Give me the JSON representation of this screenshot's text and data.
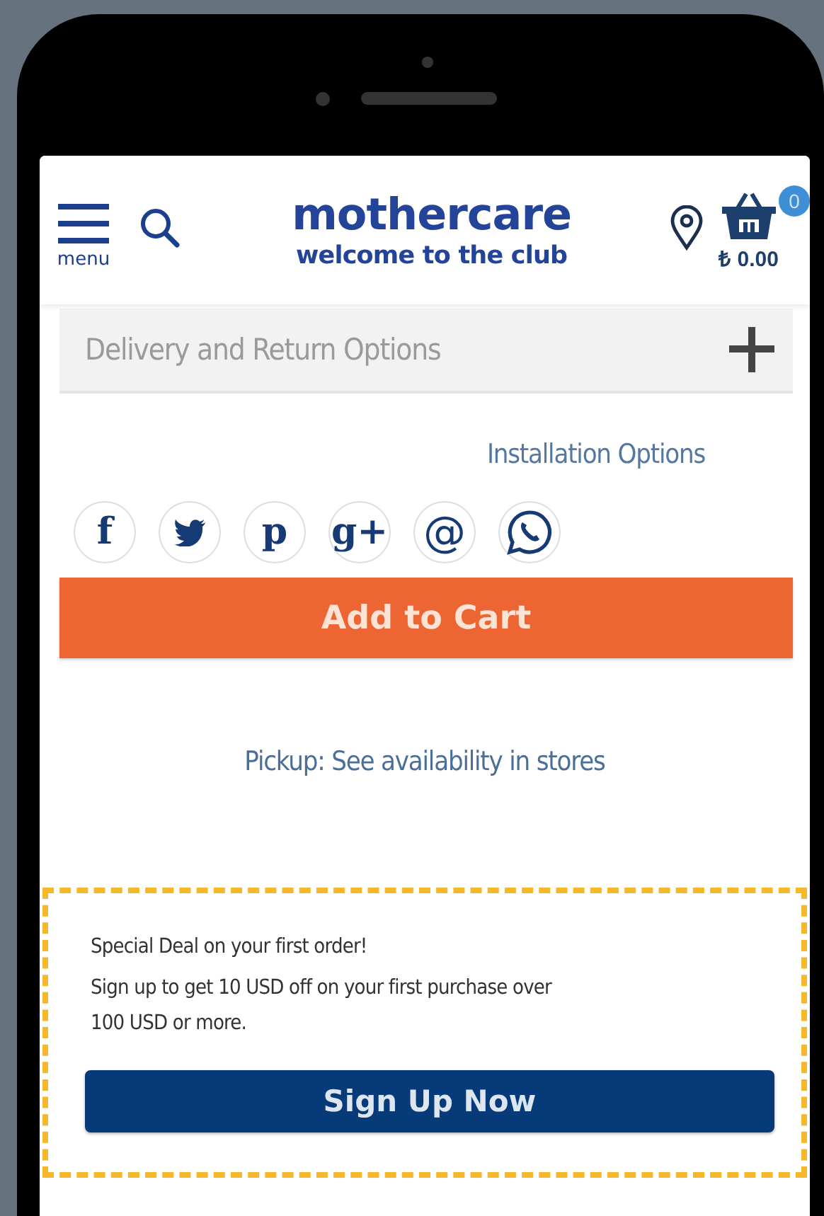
{
  "header": {
    "menu_label": "menu",
    "logo": {
      "name": "mothercare",
      "tagline": "welcome to the club"
    },
    "cart": {
      "count": "0",
      "total": "₺ 0.00"
    }
  },
  "accordion": {
    "title": "Delivery and Return Options",
    "expanded": false
  },
  "installation_link": "Installation Options",
  "share": [
    {
      "kind": "glyph",
      "text": "f"
    },
    {
      "kind": "bird"
    },
    {
      "kind": "glyph",
      "text": "p"
    },
    {
      "kind": "glyph",
      "text": "g+"
    },
    {
      "kind": "glyph",
      "text": "@"
    },
    {
      "kind": "chat"
    }
  ],
  "add_to_cart": "Add to Cart",
  "pickup_link": "Pickup: See availability in stores",
  "promo": {
    "title": "Special Deal on your first order!",
    "text": "Sign up to get 10 USD off on your first purchase over 100 USD or more.",
    "button": "Sign Up Now"
  }
}
